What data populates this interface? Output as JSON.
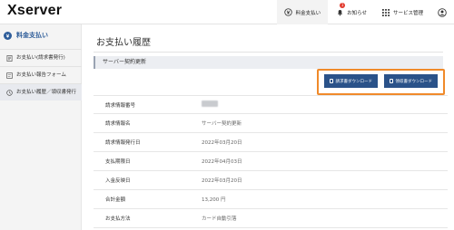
{
  "app": {
    "logo": "Xserver"
  },
  "nav": {
    "items": [
      {
        "label": "料金支払い",
        "icon": "yen-circle-icon",
        "active": true
      },
      {
        "label": "お知らせ",
        "icon": "bell-icon",
        "badge": "1"
      },
      {
        "label": "サービス管理",
        "icon": "grid-icon"
      },
      {
        "label": "",
        "icon": "user-icon"
      }
    ]
  },
  "sidebar": {
    "title": "料金支払い",
    "items": [
      {
        "label": "お支払い(請求書発行)",
        "icon": "document-icon"
      },
      {
        "label": "お支払い報告フォーム",
        "icon": "form-icon"
      },
      {
        "label": "お支払い履歴／領収書発行",
        "icon": "clock-icon",
        "active": true
      }
    ]
  },
  "main": {
    "page_title": "お支払い履歴",
    "section_title": "サーバー契約更新",
    "buttons": {
      "invoice": "請求書ダウンロード",
      "receipt": "領収書ダウンロード"
    },
    "rows": [
      {
        "label": "請求情報番号",
        "value": ""
      },
      {
        "label": "請求情報名",
        "value": "サーバー契約更新"
      },
      {
        "label": "請求情報発行日",
        "value": "2022年03月20日"
      },
      {
        "label": "支払期限日",
        "value": "2022年04月03日"
      },
      {
        "label": "入金反映日",
        "value": "2022年03月20日"
      },
      {
        "label": "合計金額",
        "value": "13,200 円"
      },
      {
        "label": "お支払方法",
        "value": "カード自動引落"
      }
    ]
  },
  "colors": {
    "brand": "#2a5289",
    "highlight": "#f08a2a",
    "badge": "#e23b2e"
  }
}
